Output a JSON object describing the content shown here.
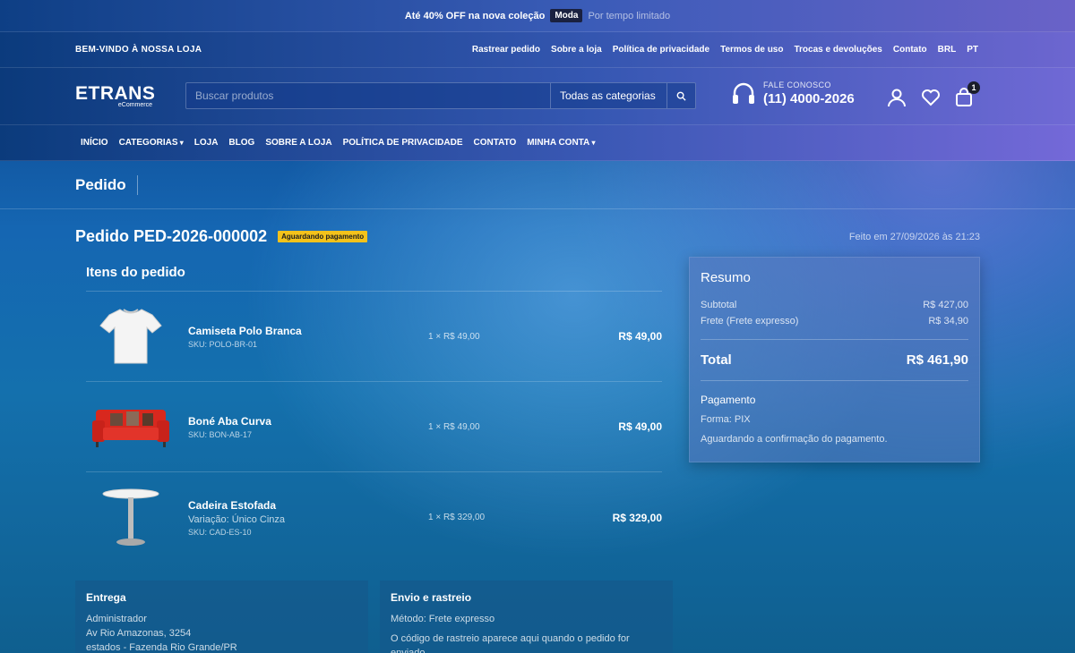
{
  "promo": {
    "text": "Até 40% OFF na nova coleção",
    "tag": "Moda",
    "note": "Por tempo limitado"
  },
  "util": {
    "welcome": "BEM-VINDO À NOSSA LOJA",
    "links": [
      "Rastrear pedido",
      "Sobre a loja",
      "Política de privacidade",
      "Termos de uso",
      "Trocas e devoluções",
      "Contato",
      "BRL",
      "PT"
    ]
  },
  "header": {
    "logo_main": "ETRANS",
    "logo_sub": "eCommerce",
    "search_placeholder": "Buscar produtos",
    "category_select": "Todas as categorias",
    "contact_label": "FALE CONOSCO",
    "contact_phone": "(11) 4000-2026",
    "cart_count": "1"
  },
  "nav": [
    "INÍCIO",
    "CATEGORIAS",
    "LOJA",
    "BLOG",
    "SOBRE A LOJA",
    "POLÍTICA DE PRIVACIDADE",
    "CONTATO",
    "MINHA CONTA"
  ],
  "page_title": "Pedido",
  "order": {
    "title": "Pedido PED-2026-000002",
    "status": "Aguardando pagamento",
    "placed": "Feito em 27/09/2026 às 21:23"
  },
  "items": {
    "heading": "Itens do pedido",
    "rows": [
      {
        "name": "Camiseta Polo Branca",
        "variation": "",
        "sku": "SKU: POLO-BR-01",
        "qty": "1 × R$ 49,00",
        "total": "R$ 49,00",
        "image": "tshirt-image"
      },
      {
        "name": "Boné Aba Curva",
        "variation": "",
        "sku": "SKU: BON-AB-17",
        "qty": "1 × R$ 49,00",
        "total": "R$ 49,00",
        "image": "sofa-image"
      },
      {
        "name": "Cadeira Estofada",
        "variation": "Variação: Único Cinza",
        "sku": "SKU: CAD-ES-10",
        "qty": "1 × R$ 329,00",
        "total": "R$ 329,00",
        "image": "table-image"
      }
    ]
  },
  "summary": {
    "heading": "Resumo",
    "subtotal_label": "Subtotal",
    "subtotal": "R$ 427,00",
    "shipping_label": "Frete (Frete expresso)",
    "shipping": "R$ 34,90",
    "total_label": "Total",
    "total": "R$ 461,90",
    "payment_heading": "Pagamento",
    "payment_method": "Forma: PIX",
    "payment_status": "Aguardando a confirmação do pagamento."
  },
  "delivery": {
    "heading": "Entrega",
    "lines": [
      "Administrador",
      "Av Rio Amazonas, 3254",
      "estados - Fazenda Rio Grande/PR"
    ]
  },
  "shipping_card": {
    "heading": "Envio e rastreio",
    "method": "Método: Frete expresso",
    "note": "O código de rastreio aparece aqui quando o pedido for enviado."
  }
}
